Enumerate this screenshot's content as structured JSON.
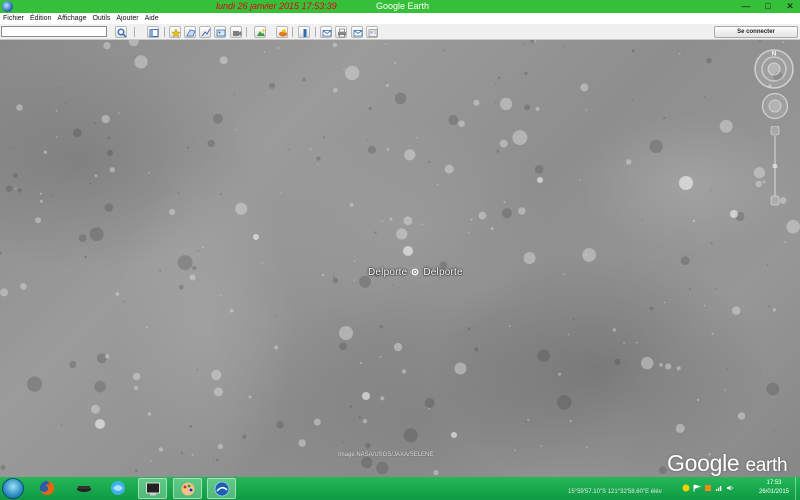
{
  "window": {
    "clock_title": "lundi 26 janvier 2015  17:53:39",
    "title": "Google Earth",
    "controls": {
      "minimize": "—",
      "maximize": "□",
      "close": "✕"
    }
  },
  "menu": [
    "Fichier",
    "Édition",
    "Affichage",
    "Outils",
    "Ajouter",
    "Aide"
  ],
  "toolbar": {
    "search_value": "",
    "signin_label": "Se connecter",
    "buttons": [
      "search-icon",
      "sidebar-icon",
      "placemark-icon",
      "polygon-icon",
      "path-icon",
      "image-overlay-icon",
      "record-tour-icon",
      "historical-imagery-icon",
      "sunlight-icon",
      "planets-icon",
      "ruler-icon",
      "email-icon",
      "print-icon",
      "maps-icon"
    ]
  },
  "map": {
    "place_label_left": "Delporte",
    "place_label_right": "Delporte",
    "imagery_credit": "Image NASA/USGS/JAXA/SELENE",
    "logo_google": "Google",
    "logo_earth": "earth",
    "compass_north": "N"
  },
  "status": {
    "coords": "15°59'57.10\"S  121°32'58.60\"E  élév"
  },
  "taskbar": {
    "apps": [
      "windows-explorer-icon",
      "firefox-icon",
      "media-icon",
      "browser-icon",
      "screen-icon",
      "paint-icon",
      "google-earth-icon"
    ],
    "time": "17:53",
    "date": "26/01/2015"
  },
  "colors": {
    "titlebar": "#36c03a",
    "clock_title": "#e4001a",
    "taskbar": "#15a64b",
    "moon_surface": "#8f8f8f"
  }
}
